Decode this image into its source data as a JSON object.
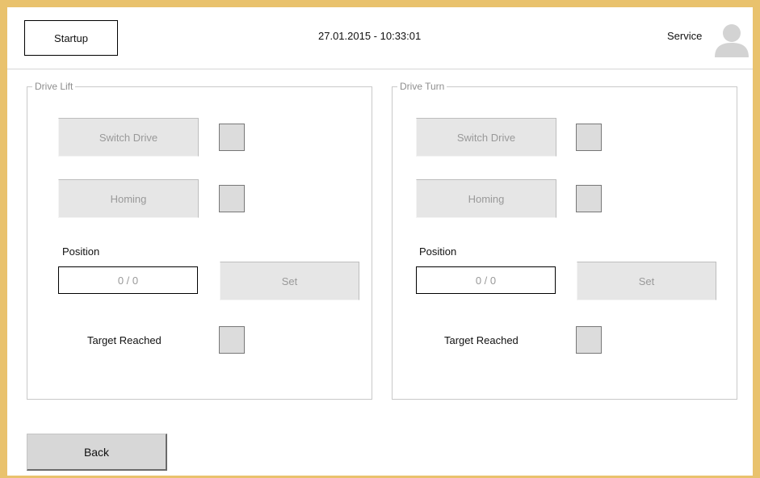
{
  "header": {
    "startup_label": "Startup",
    "datetime": "27.01.2015 - 10:33:01",
    "service_label": "Service",
    "user_icon": "user-avatar-icon"
  },
  "panels": [
    {
      "title": "Drive Lift",
      "switch_drive_label": "Switch Drive",
      "homing_label": "Homing",
      "position_label": "Position",
      "position_value": "0 / 0",
      "set_label": "Set",
      "target_reached_label": "Target Reached"
    },
    {
      "title": "Drive Turn",
      "switch_drive_label": "Switch Drive",
      "homing_label": "Homing",
      "position_label": "Position",
      "position_value": "0 / 0",
      "set_label": "Set",
      "target_reached_label": "Target Reached"
    }
  ],
  "footer": {
    "back_label": "Back"
  },
  "colors": {
    "frame": "#e9c26d",
    "indicator": "#dcdcdc",
    "disabled_button": "#e6e6e6"
  }
}
